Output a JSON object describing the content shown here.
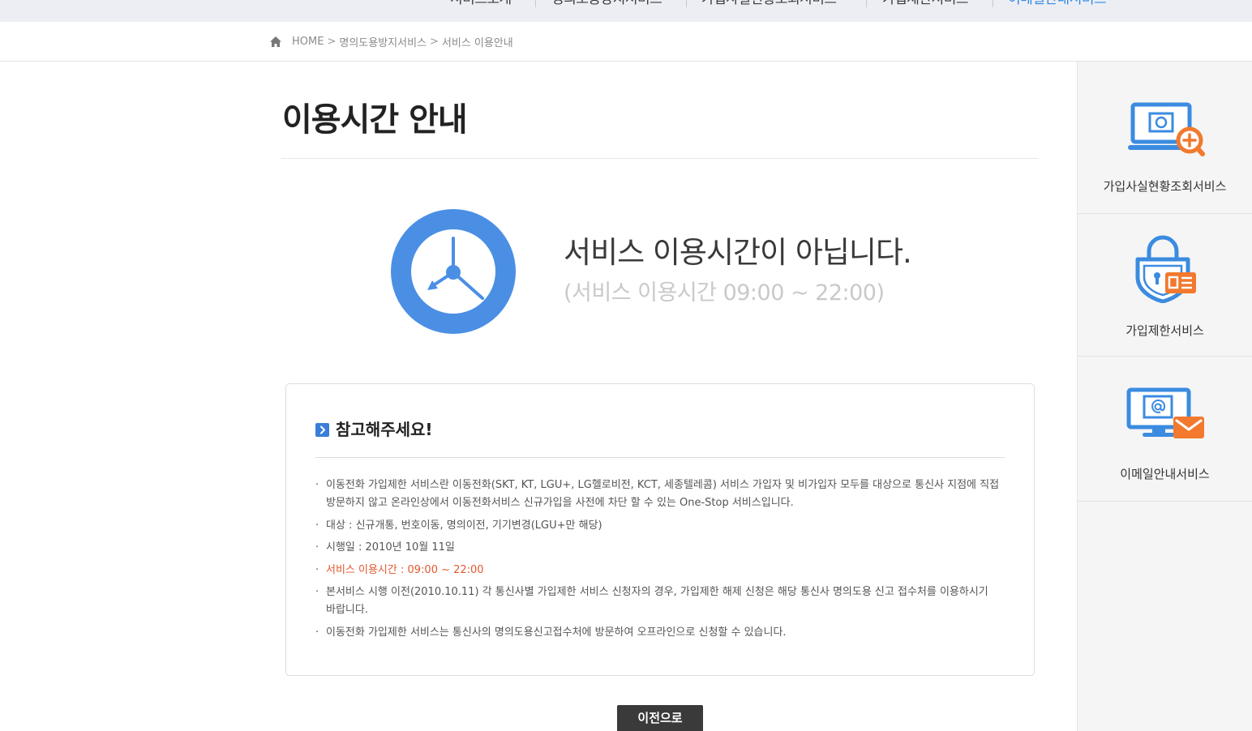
{
  "colors": {
    "accent": "#4a8fe4",
    "nav_active": "#2f8ae5",
    "highlight": "#e4572e",
    "icon_blue": "#3b8be0",
    "icon_orange": "#f2792e",
    "button_bg": "#3a3a3a"
  },
  "top_nav": {
    "items": [
      {
        "label": "서비스소개",
        "active": false
      },
      {
        "label": "명의도용방지서비스",
        "active": false
      },
      {
        "label": "가입사실현황조회서비스",
        "active": false
      },
      {
        "label": "가입제한서비스",
        "active": false
      },
      {
        "label": "이메일안내서비스",
        "active": true
      }
    ]
  },
  "breadcrumb": {
    "home_icon": "home-icon",
    "home": "HOME",
    "separator": ">",
    "items": [
      "명의도용방지서비스",
      "서비스 이용안내"
    ]
  },
  "page": {
    "title": "이용시간 안내"
  },
  "status": {
    "icon": "clock-icon",
    "message": "서비스 이용시간이 아닙니다.",
    "hours": "(서비스 이용시간 09:00 ~ 22:00)"
  },
  "notice": {
    "icon": "chevron-right-icon",
    "heading": "참고해주세요!",
    "items": [
      {
        "text": "이동전화 가입제한 서비스란 이동전화(SKT, KT, LGU+, LG헬로비전, KCT, 세종텔레콤) 서비스 가입자 및 비가입자 모두를 대상으로 통신사 지점에 직접 방문하지 않고 온라인상에서 이동전화서비스 신규가입을 사전에 차단 할 수 있는 One-Stop 서비스입니다.",
        "highlight": false
      },
      {
        "text": "대상 : 신규개통, 번호이동, 명의이전, 기기변경(LGU+만 해당)",
        "highlight": false
      },
      {
        "text": "시행일 : 2010년 10월 11일",
        "highlight": false
      },
      {
        "text": "서비스 이용시간 : 09:00 ~ 22:00",
        "highlight": true
      },
      {
        "text": "본서비스 시행 이전(2010.10.11) 각 통신사별 가입제한 서비스 신청자의 경우, 가입제한 해제 신청은 해당 통신사 명의도용 신고 접수처를 이용하시기 바랍니다.",
        "highlight": false
      },
      {
        "text": "이동전화 가입제한 서비스는 통신사의 명의도용신고접수처에 방문하여 오프라인으로 신청할 수 있습니다.",
        "highlight": false
      }
    ]
  },
  "actions": {
    "back_label": "이전으로"
  },
  "sidebar": {
    "items": [
      {
        "label": "가입사실현황조회서비스",
        "icon": "laptop-search-icon"
      },
      {
        "label": "가입제한서비스",
        "icon": "lock-id-card-icon"
      },
      {
        "label": "이메일안내서비스",
        "icon": "monitor-email-icon"
      }
    ]
  }
}
